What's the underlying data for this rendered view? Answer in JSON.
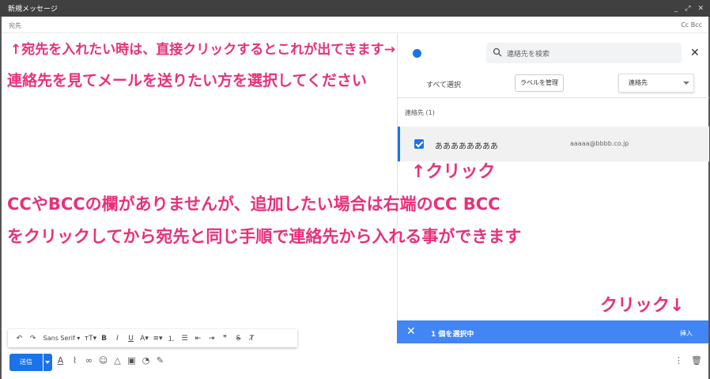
{
  "window": {
    "title": "新規メッセージ",
    "controls": [
      "_",
      "⤢",
      "✕"
    ]
  },
  "recipients": {
    "to_label": "宛先",
    "cc_bcc": "Cc Bcc"
  },
  "contacts_panel": {
    "search_placeholder": "連絡先を検索",
    "select_all": "すべて選択",
    "manage_labels": "ラベルを管理",
    "dropdown_value": "連絡先",
    "section_label": "連絡先 (1)",
    "contacts": [
      {
        "name": "ああああああああ",
        "email": "aaaaa@bbbb.co.jp",
        "selected": true
      }
    ],
    "selection_count": "1 個を選択中",
    "insert_label": "挿入"
  },
  "toolbar": {
    "font": "Sans Serif",
    "send_label": "送信"
  },
  "annotations": {
    "a1": "↑宛先を入れたい時は、直接クリックするとこれが出てきます→",
    "a2": "連絡先を見てメールを送りたい方を選択してください",
    "a3": "↑クリック",
    "a4": "CCやBCCの欄がありませんが、追加したい場合は右端のCC BCC",
    "a5": "をクリックしてから宛先と同じ手順で連絡先から入れる事ができます",
    "a6": "クリック↓"
  },
  "colors": {
    "accent": "#1a73e8",
    "selection_bar": "#4285f4",
    "annotation": "#e8307a",
    "titlebar": "#404040"
  }
}
